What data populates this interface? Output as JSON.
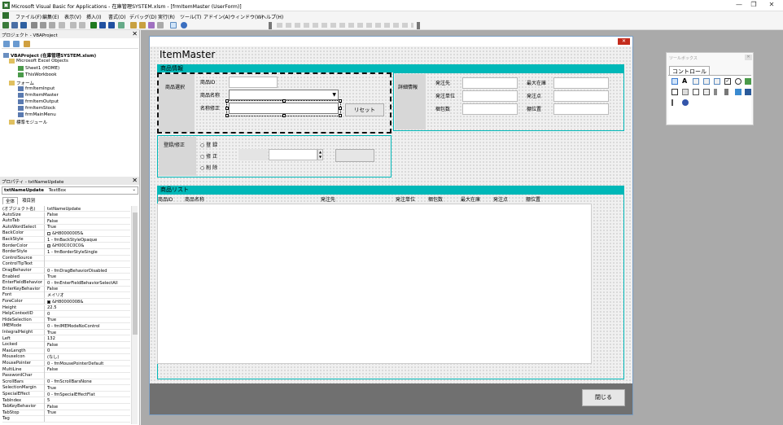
{
  "window": {
    "title": "Microsoft Visual Basic for Applications - 在庫管理SYSTEM.xlsm - [frmItemMaster (UserForm)]",
    "minimize": "—",
    "maximize": "❐",
    "close": "✕"
  },
  "menu": [
    "ファイル(F)",
    "編集(E)",
    "表示(V)",
    "挿入(I)",
    "書式(O)",
    "デバッグ(D)",
    "実行(R)",
    "ツール(T)",
    "アドイン(A)",
    "ウィンドウ(W)",
    "ヘルプ(H)"
  ],
  "project": {
    "title": "プロジェクト - VBAProject",
    "close": "✕",
    "root": "VBAProject (在庫管理SYSTEM.xlsm)",
    "excel_objects": "Microsoft Excel Objects",
    "sheet1": "Sheet1 (HOME)",
    "thisworkbook": "ThisWorkbook",
    "forms_folder": "フォーム",
    "forms": [
      "frmItemInput",
      "frmItemMaster",
      "frmItemOutput",
      "frmItemStock",
      "frmMainMenu"
    ],
    "modules": "標準モジュール"
  },
  "properties": {
    "title": "プロパティ - txtNameUpdate",
    "close": "✕",
    "object_name": "txtNameUpdate",
    "object_type": "TextBox",
    "tabs": [
      "全体",
      "項目別"
    ],
    "rows": [
      {
        "name": "(オブジェクト名)",
        "value": "txtNameUpdate"
      },
      {
        "name": "AutoSize",
        "value": "False"
      },
      {
        "name": "AutoTab",
        "value": "False"
      },
      {
        "name": "AutoWordSelect",
        "value": "True"
      },
      {
        "name": "BackColor",
        "value": "&H80000005&",
        "swatch": "#ffffff"
      },
      {
        "name": "BackStyle",
        "value": "1 - fmBackStyleOpaque"
      },
      {
        "name": "BorderColor",
        "value": "&H00C0C0C0&",
        "swatch": "#c0c0c0"
      },
      {
        "name": "BorderStyle",
        "value": "1 - fmBorderStyleSingle"
      },
      {
        "name": "ControlSource",
        "value": ""
      },
      {
        "name": "ControlTipText",
        "value": ""
      },
      {
        "name": "DragBehavior",
        "value": "0 - fmDragBehaviorDisabled"
      },
      {
        "name": "Enabled",
        "value": "True"
      },
      {
        "name": "EnterFieldBehavior",
        "value": "0 - fmEnterFieldBehaviorSelectAll"
      },
      {
        "name": "EnterKeyBehavior",
        "value": "False"
      },
      {
        "name": "Font",
        "value": "メイリオ"
      },
      {
        "name": "ForeColor",
        "value": "&H80000008&",
        "swatch": "#000000"
      },
      {
        "name": "Height",
        "value": "22.5"
      },
      {
        "name": "HelpContextID",
        "value": "0"
      },
      {
        "name": "HideSelection",
        "value": "True"
      },
      {
        "name": "IMEMode",
        "value": "0 - fmIMEModeNoControl"
      },
      {
        "name": "IntegralHeight",
        "value": "True"
      },
      {
        "name": "Left",
        "value": "132"
      },
      {
        "name": "Locked",
        "value": "False"
      },
      {
        "name": "MaxLength",
        "value": "0"
      },
      {
        "name": "MouseIcon",
        "value": "(なし)"
      },
      {
        "name": "MousePointer",
        "value": "0 - fmMousePointerDefault"
      },
      {
        "name": "MultiLine",
        "value": "False"
      },
      {
        "name": "PasswordChar",
        "value": ""
      },
      {
        "name": "ScrollBars",
        "value": "0 - fmScrollBarsNone"
      },
      {
        "name": "SelectionMargin",
        "value": "True"
      },
      {
        "name": "SpecialEffect",
        "value": "0 - fmSpecialEffectFlat"
      },
      {
        "name": "TabIndex",
        "value": "5"
      },
      {
        "name": "TabKeyBehavior",
        "value": "False"
      },
      {
        "name": "TabStop",
        "value": "True"
      },
      {
        "name": "Tag",
        "value": ""
      }
    ]
  },
  "form": {
    "close": "✕",
    "heading": "ItemMaster",
    "section_info": "商品情報",
    "select_label": "商品選択",
    "item_id_label": "商品ID",
    "item_name_label": "商品名称",
    "name_edit_label": "名称修正",
    "reset_button": "リセット",
    "detail_label": "詳細情報",
    "supplier_label": "発注先",
    "order_unit_label": "発注単位",
    "pack_qty_label": "梱包数",
    "max_stock_label": "最大在庫",
    "order_point_label": "発注点",
    "location_label": "棚位置",
    "register_label": "登録/修正",
    "radio_register": "登 録",
    "radio_edit": "修 正",
    "radio_delete": "削 除",
    "section_list": "商品リスト",
    "list_headers": [
      "商品ID",
      "商品名称",
      "発注先",
      "発注単位",
      "梱包数",
      "最大在庫",
      "発注点",
      "棚位置"
    ],
    "close_button": "閉じる"
  },
  "toolbox": {
    "title": "ツールボックス",
    "close": "✕",
    "tab": "コントロール"
  }
}
